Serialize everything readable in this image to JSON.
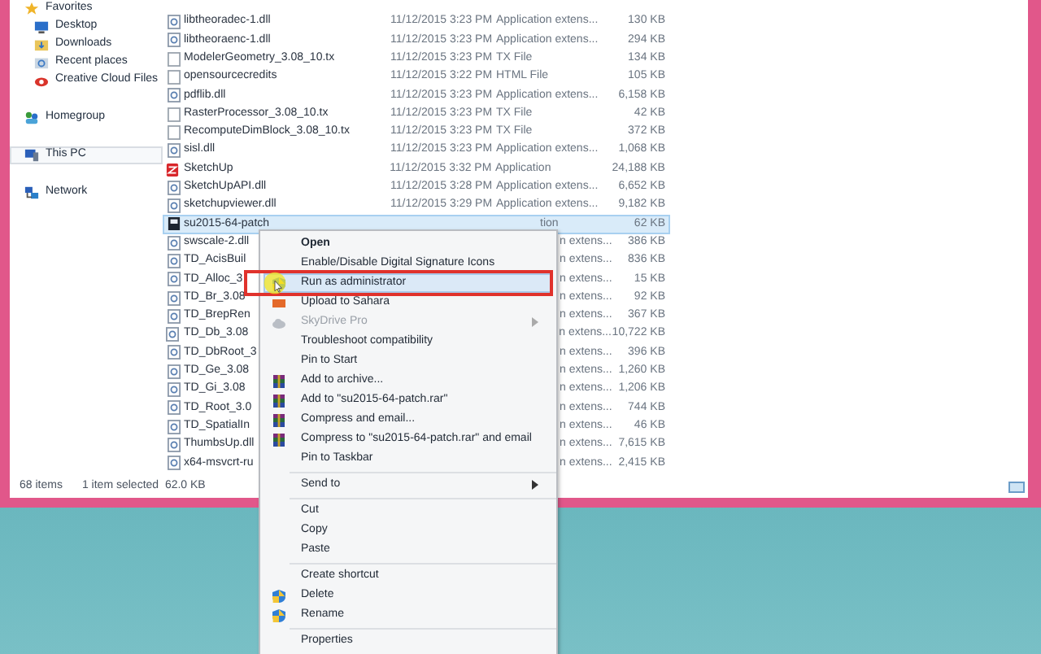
{
  "sidebar": {
    "items": [
      {
        "label": "Favorites",
        "selected": false,
        "children": [
          {
            "label": "Desktop",
            "selected": false
          },
          {
            "label": "Downloads",
            "selected": false
          },
          {
            "label": "Recent places",
            "selected": false
          },
          {
            "label": "Creative Cloud Files",
            "selected": false
          }
        ]
      },
      {
        "label": "Homegroup",
        "selected": false
      },
      {
        "label": "This PC",
        "selected": true
      },
      {
        "label": "Network",
        "selected": false
      }
    ]
  },
  "files": [
    {
      "kind": "dll",
      "name": "libtheoradec-1.dll",
      "date": "11/12/2015 3:23 PM",
      "type": "Application extens...",
      "size": "130 KB",
      "selected": false
    },
    {
      "kind": "dll",
      "name": "libtheoraenc-1.dll",
      "date": "11/12/2015 3:23 PM",
      "type": "Application extens...",
      "size": "294 KB",
      "selected": false
    },
    {
      "kind": "text",
      "name": "ModelerGeometry_3.08_10.tx",
      "date": "11/12/2015 3:23 PM",
      "type": "TX File",
      "size": "134 KB",
      "selected": false
    },
    {
      "kind": "text",
      "name": "opensourcecredits",
      "date": "11/12/2015 3:22 PM",
      "type": "HTML File",
      "size": "105 KB",
      "selected": false
    },
    {
      "kind": "dll",
      "name": "pdflib.dll",
      "date": "11/12/2015 3:23 PM",
      "type": "Application extens...",
      "size": "6,158 KB",
      "selected": false
    },
    {
      "kind": "text",
      "name": "RasterProcessor_3.08_10.tx",
      "date": "11/12/2015 3:23 PM",
      "type": "TX File",
      "size": "42 KB",
      "selected": false
    },
    {
      "kind": "text",
      "name": "RecomputeDimBlock_3.08_10.tx",
      "date": "11/12/2015 3:23 PM",
      "type": "TX File",
      "size": "372 KB",
      "selected": false
    },
    {
      "kind": "dll",
      "name": "sisl.dll",
      "date": "11/12/2015 3:23 PM",
      "type": "Application extens...",
      "size": "1,068 KB",
      "selected": false
    },
    {
      "kind": "app",
      "name": "SketchUp",
      "date": "11/12/2015 3:32 PM",
      "type": "Application",
      "size": "24,188 KB",
      "selected": false
    },
    {
      "kind": "dll",
      "name": "SketchUpAPI.dll",
      "date": "11/12/2015 3:28 PM",
      "type": "Application extens...",
      "size": "6,652 KB",
      "selected": false
    },
    {
      "kind": "dll",
      "name": "sketchupviewer.dll",
      "date": "11/12/2015 3:29 PM",
      "type": "Application extens...",
      "size": "9,182 KB",
      "selected": false
    },
    {
      "kind": "patch",
      "name": "su2015-64-patch",
      "type": "tion",
      "size": "62 KB",
      "selected": true
    },
    {
      "kind": "dll",
      "name": "swscale-2.dll",
      "type": "n extens...",
      "size": "386 KB",
      "selected": false
    },
    {
      "kind": "dll",
      "name": "TD_AcisBuil",
      "type": "n extens...",
      "size": "836 KB",
      "selected": false
    },
    {
      "kind": "dll",
      "name": "TD_Alloc_3",
      "type": "n extens...",
      "size": "15 KB",
      "selected": false
    },
    {
      "kind": "dll",
      "name": "TD_Br_3.08",
      "type": "n extens...",
      "size": "92 KB",
      "selected": false
    },
    {
      "kind": "dll",
      "name": "TD_BrepRen",
      "type": "n extens...",
      "size": "367 KB",
      "selected": false
    },
    {
      "kind": "dll",
      "name": "TD_Db_3.08",
      "type": "n extens...",
      "size": "10,722 KB",
      "selected": false
    },
    {
      "kind": "dll",
      "name": "TD_DbRoot_3",
      "type": "n extens...",
      "size": "396 KB",
      "selected": false
    },
    {
      "kind": "dll",
      "name": "TD_Ge_3.08",
      "type": "n extens...",
      "size": "1,260 KB",
      "selected": false
    },
    {
      "kind": "dll",
      "name": "TD_Gi_3.08",
      "type": "n extens...",
      "size": "1,206 KB",
      "selected": false
    },
    {
      "kind": "dll",
      "name": "TD_Root_3.0",
      "type": "n extens...",
      "size": "744 KB",
      "selected": false
    },
    {
      "kind": "dll",
      "name": "TD_SpatialIn",
      "type": "n extens...",
      "size": "46 KB",
      "selected": false
    },
    {
      "kind": "dll",
      "name": "ThumbsUp.dll",
      "type": "n extens...",
      "size": "7,615 KB",
      "selected": false
    },
    {
      "kind": "dll",
      "name": "x64-msvcrt-ru",
      "type": "n extens...",
      "size": "2,415 KB",
      "selected": false
    }
  ],
  "status_bar": {
    "count": "68 items",
    "selection": "1 item selected  62.0 KB"
  },
  "context_menu": {
    "items": [
      {
        "kind": "plain",
        "label": "Open",
        "bold": true,
        "selected": false,
        "disabled": false,
        "submenu": false
      },
      {
        "kind": "plain",
        "label": "Enable/Disable Digital Signature Icons",
        "bold": false,
        "selected": false,
        "disabled": false,
        "submenu": false
      },
      {
        "kind": "shield",
        "label": "Run as administrator",
        "bold": false,
        "selected": true,
        "disabled": false,
        "submenu": false
      },
      {
        "kind": "upload",
        "label": "Upload to Sahara",
        "bold": false,
        "selected": false,
        "disabled": false,
        "submenu": false
      },
      {
        "kind": "cloud",
        "label": "SkyDrive Pro",
        "bold": false,
        "selected": false,
        "disabled": true,
        "submenu": true
      },
      {
        "kind": "plain",
        "label": "Troubleshoot compatibility",
        "bold": false,
        "selected": false,
        "disabled": false,
        "submenu": false
      },
      {
        "kind": "plain",
        "label": "Pin to Start",
        "bold": false,
        "selected": false,
        "disabled": false,
        "submenu": false
      },
      {
        "kind": "archive",
        "label": "Add to archive...",
        "bold": false,
        "selected": false,
        "disabled": false,
        "submenu": false
      },
      {
        "kind": "archive",
        "label": "Add to \"su2015-64-patch.rar\"",
        "bold": false,
        "selected": false,
        "disabled": false,
        "submenu": false
      },
      {
        "kind": "archive",
        "label": "Compress and email...",
        "bold": false,
        "selected": false,
        "disabled": false,
        "submenu": false
      },
      {
        "kind": "archive",
        "label": "Compress to \"su2015-64-patch.rar\" and email",
        "bold": false,
        "selected": false,
        "disabled": false,
        "submenu": false
      },
      {
        "kind": "plain",
        "label": "Pin to Taskbar",
        "bold": false,
        "selected": false,
        "disabled": false,
        "submenu": false
      },
      {
        "kind": "separator"
      },
      {
        "kind": "plain",
        "label": "Send to",
        "bold": false,
        "selected": false,
        "disabled": false,
        "submenu": true
      },
      {
        "kind": "separator"
      },
      {
        "kind": "plain",
        "label": "Cut",
        "bold": false,
        "selected": false,
        "disabled": false,
        "submenu": false
      },
      {
        "kind": "plain",
        "label": "Copy",
        "bold": false,
        "selected": false,
        "disabled": false,
        "submenu": false
      },
      {
        "kind": "plain",
        "label": "Paste",
        "bold": false,
        "selected": false,
        "disabled": false,
        "submenu": false
      },
      {
        "kind": "separator"
      },
      {
        "kind": "plain",
        "label": "Create shortcut",
        "bold": false,
        "selected": false,
        "disabled": false,
        "submenu": false
      },
      {
        "kind": "shield",
        "label": "Delete",
        "bold": false,
        "selected": false,
        "disabled": false,
        "submenu": false
      },
      {
        "kind": "shield",
        "label": "Rename",
        "bold": false,
        "selected": false,
        "disabled": false,
        "submenu": false
      },
      {
        "kind": "separator"
      },
      {
        "kind": "plain",
        "label": "Properties",
        "bold": false,
        "selected": false,
        "disabled": false,
        "submenu": false
      }
    ]
  }
}
